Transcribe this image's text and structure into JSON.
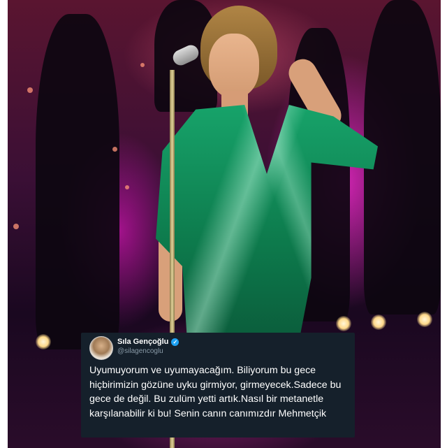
{
  "tweet": {
    "display_name": "Sıla Gençoğlu",
    "handle": "@silagencoglu",
    "verified_icon": "verified-badge-icon",
    "text": "Uyumuyorum ve uyumayacağım. Biliyorum bu gece hiçbirimizin gözüne uyku girmiyor, girmeyecek.Sadece bu gece de değil. Bu zulüm yetti artık.Nasıl bir metanetle karşılanabilir ki bu! Senin canın canımızdır Mehmetçik"
  },
  "colors": {
    "tweet_background": "#15202b",
    "verified_blue": "#1da1f2",
    "dress_green": "#17a36a",
    "stage_magenta": "#eb28c8"
  }
}
